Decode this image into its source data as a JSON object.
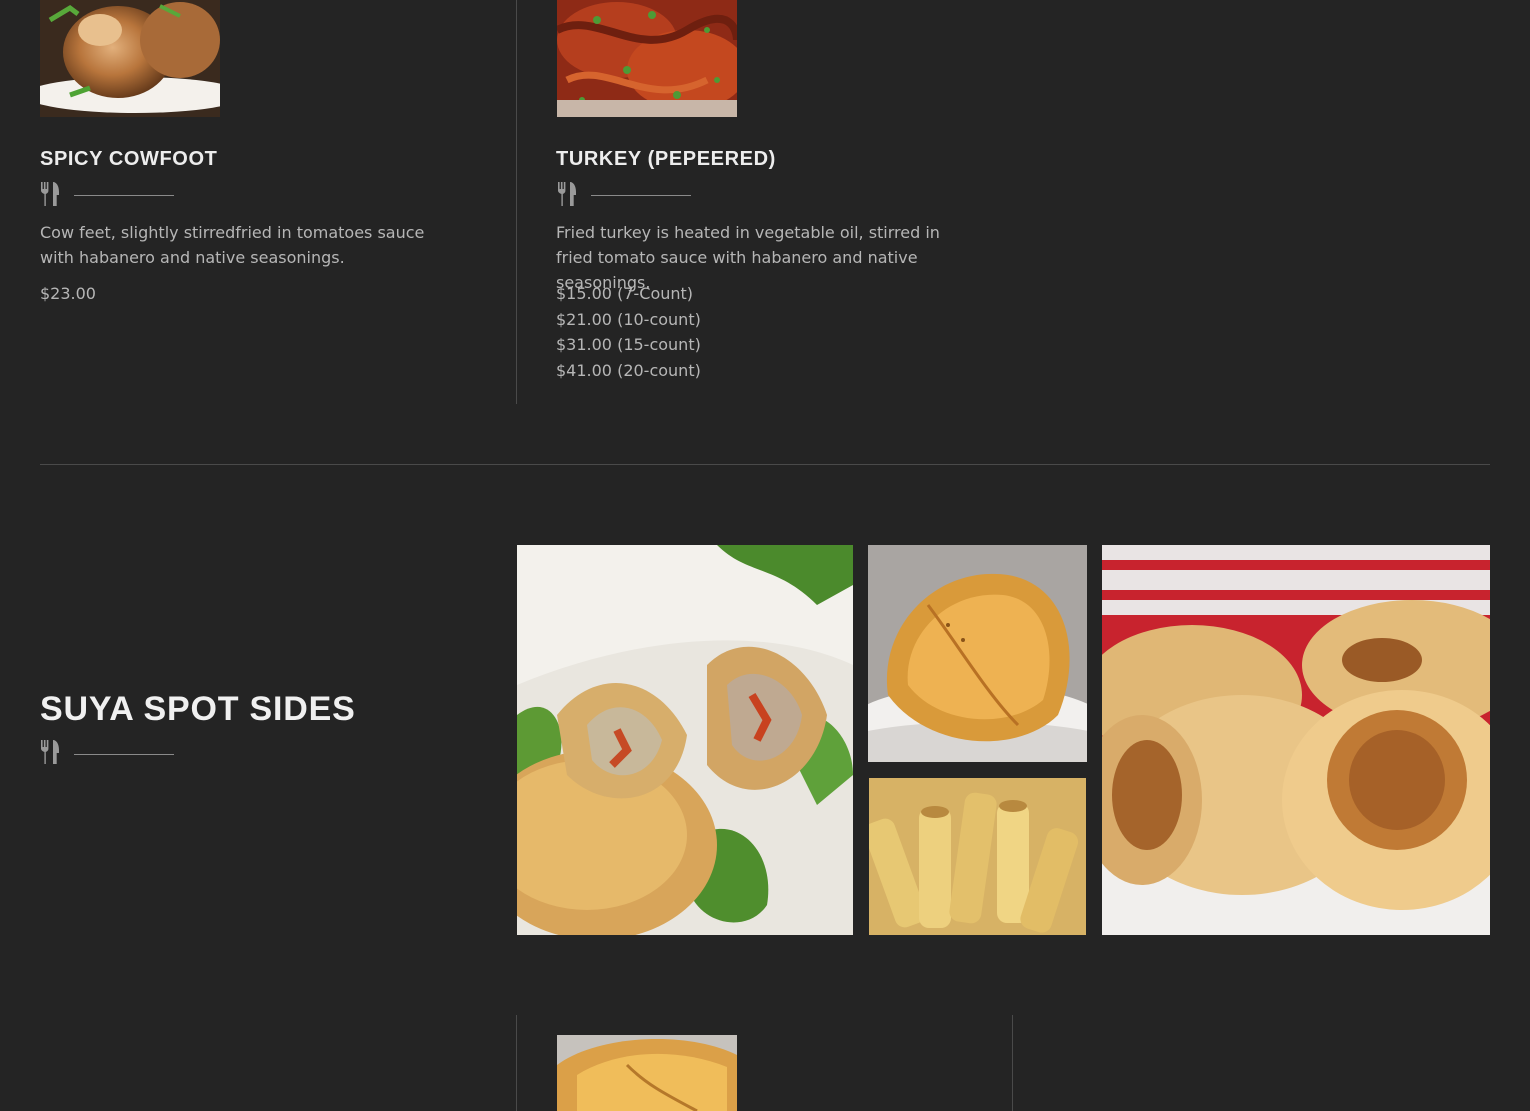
{
  "items": [
    {
      "title": "SPICY COWFOOT",
      "image": "cowfoot-photo",
      "description": "Cow feet, slightly stirredfried in tomatoes sauce with habanero and native seasonings.",
      "prices": [
        "$23.00"
      ]
    },
    {
      "title": "TURKEY (PEPEERED)",
      "image": "peppered-turkey-photo",
      "description": "Fried turkey is heated in vegetable oil, stirred in fried tomato sauce with habanero and native seasonings.",
      "prices": [
        "$15.00 (7-Count)",
        "$21.00 (10-count)",
        "$31.00 (15-count)",
        "$41.00 (20-count)"
      ]
    }
  ],
  "section": {
    "title": "SUYA SPOT SIDES",
    "gallery": [
      "meat-pie-halves-photo",
      "meat-pie-photo",
      "spring-rolls-photo",
      "sausage-rolls-photo"
    ]
  },
  "icons": {
    "divider": "fork-knife-icon"
  },
  "colors": {
    "background": "#242424",
    "heading": "#ededed",
    "text": "#b6b6b6",
    "divider": "#4a4a4a"
  }
}
